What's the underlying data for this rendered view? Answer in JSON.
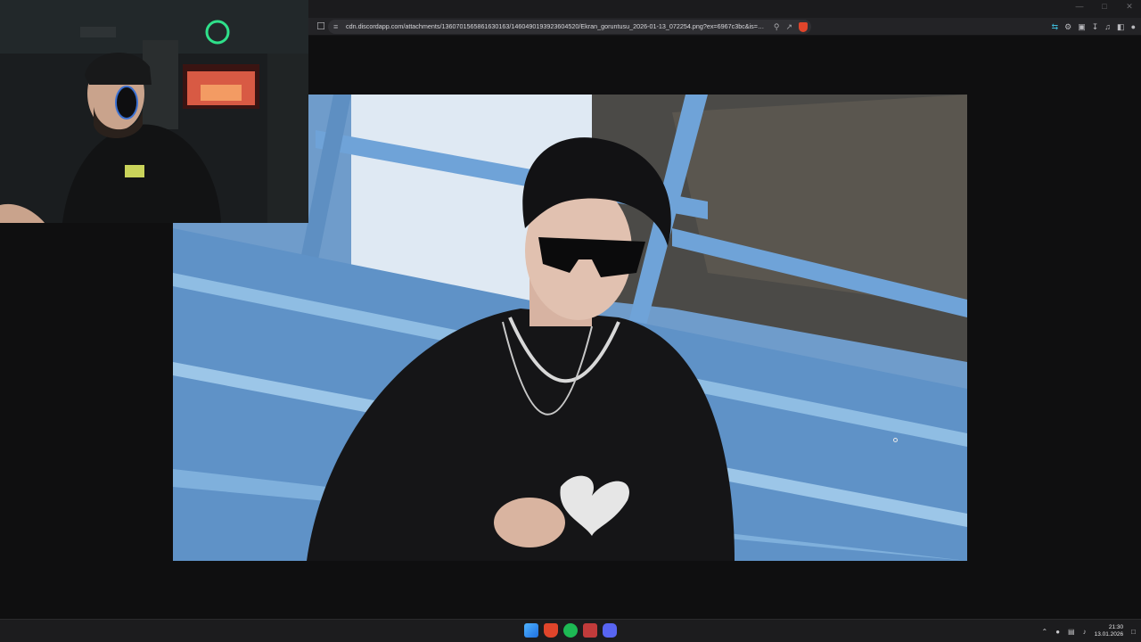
{
  "browser": {
    "url": "cdn.discordapp.com/attachments/1360701565861630163/1460490193923604520/Ekran_goruntusu_2026-01-13_072254.png?ex=6967c3bc&is=6966...",
    "window_controls": [
      "—",
      "□",
      "✕"
    ],
    "icons": {
      "bookmark": "bookmark-icon",
      "site_settings": "tune-icon",
      "zoom": "search-icon",
      "share": "share-icon",
      "brave_shield": "brave-shield-icon",
      "translate": "translate-icon",
      "extensions": "puzzle-icon",
      "wallet": "wallet-icon",
      "downloads": "download-icon",
      "media": "music-icon",
      "sidebar": "sidebar-icon",
      "profile": "person-icon"
    }
  },
  "image": {
    "description_colors": {
      "sky": "#cfe0ef",
      "bench": "#5f90c4",
      "shirt": "#151517"
    }
  },
  "taskbar": {
    "apps": [
      "start-icon",
      "brave-icon",
      "spotify-icon",
      "media-app-icon",
      "discord-icon"
    ],
    "clock_time": "21:30",
    "clock_date": "13.01.2026"
  }
}
